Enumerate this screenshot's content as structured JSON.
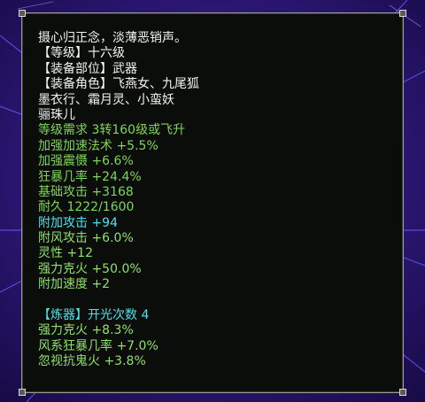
{
  "tooltip": {
    "lines": [
      {
        "text": "摄心归正念，淡薄恶销声。",
        "color": "white"
      },
      {
        "text": "【等级】十六级",
        "color": "white"
      },
      {
        "text": "【装备部位】武器",
        "color": "white"
      },
      {
        "text": "【装备角色】飞燕女、九尾狐",
        "color": "white"
      },
      {
        "text": "墨衣行、霜月灵、小蛮妖",
        "color": "white"
      },
      {
        "text": "骊珠儿",
        "color": "white"
      },
      {
        "text": "等级需求 3转160级或飞升",
        "color": "green"
      },
      {
        "text": "加强加速法术 +5.5%",
        "color": "green"
      },
      {
        "text": "加强震慑 +6.6%",
        "color": "green"
      },
      {
        "text": "狂暴几率 +24.4%",
        "color": "green"
      },
      {
        "text": "基础攻击 +3168",
        "color": "green"
      },
      {
        "text": "耐久 1222/1600",
        "color": "green"
      },
      {
        "text": "附加攻击 +94",
        "color": "cyan"
      },
      {
        "text": "附风攻击 +6.0%",
        "color": "lgreen"
      },
      {
        "text": "灵性 +12",
        "color": "lgreen"
      },
      {
        "text": "强力克火 +50.0%",
        "color": "lgreen"
      },
      {
        "text": "附加速度 +2",
        "color": "lgreen"
      },
      {
        "text": "",
        "color": "white"
      },
      {
        "text": "【炼器】开光次数 4",
        "color": "cyan"
      },
      {
        "text": "强力克火 +8.3%",
        "color": "lgreen"
      },
      {
        "text": "风系狂暴几率 +7.0%",
        "color": "lgreen"
      },
      {
        "text": "忽视抗鬼火 +3.8%",
        "color": "lgreen"
      }
    ]
  }
}
